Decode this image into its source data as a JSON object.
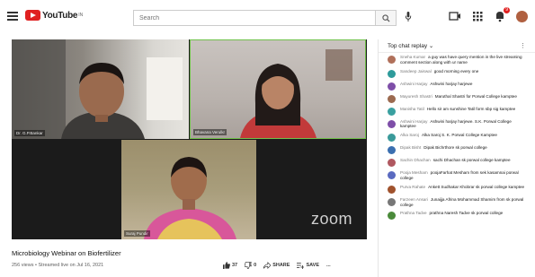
{
  "header": {
    "logo_text": "YouTube",
    "logo_sup": "IN",
    "search_placeholder": "Search",
    "notifications_badge": "9"
  },
  "video": {
    "title": "Microbiology Webinar on Biofertilizer",
    "meta": "256 views • Streamed live on Jul 16, 2021",
    "zoom_watermark": "zoom",
    "tiles": [
      {
        "name": "Dr. G.P.Bankar"
      },
      {
        "name": "Bhavana Verulkr"
      },
      {
        "name": "Suraj Pundir"
      }
    ],
    "actions": {
      "likes": "37",
      "dislikes": "0",
      "share": "SHARE",
      "save": "SAVE",
      "more": "..."
    }
  },
  "chat": {
    "header": "Top chat replay",
    "messages": [
      {
        "author": "Sneha Kumar",
        "text": "a guy was have query mention in the live streaming comment section along with ur name",
        "color": "#b0705a"
      },
      {
        "author": "Sandeep Jaiswal",
        "text": "good morning every one",
        "color": "#2e9b9b"
      },
      {
        "author": "Ashwini Harjay",
        "text": "Ashwini harjay harjewe",
        "color": "#7e4ea8"
      },
      {
        "author": "Mayuresh Shastri",
        "text": "Maruthal Shastri for Porwal College kamptee",
        "color": "#9c6a50"
      },
      {
        "author": "Manisha Tatil",
        "text": "Hello sir am sunshine Tatil form sbp sig kamptee",
        "color": "#3aa0a0"
      },
      {
        "author": "Ashwini Harjay",
        "text": "Ashwini harjay harjewe. S.K. Porwal College kamptee",
        "color": "#7e4ea8"
      },
      {
        "author": "Alka Saroj",
        "text": "Alka Saroj S. K. Porwal College Kamptee",
        "color": "#3a9a9a"
      },
      {
        "author": "Dipak Bisht",
        "text": "Dipak Bichrthore sk porwal college",
        "color": "#3b6fb0"
      },
      {
        "author": "Sachin Dhachan",
        "text": "sachi Dhachan sk porwal college kamptee",
        "color": "#b05860"
      },
      {
        "author": "Pooja Mesham",
        "text": "poojaFarhat Mesham from sek kasamnai porwal college",
        "color": "#5a6ac0"
      },
      {
        "author": "Purva Rahate",
        "text": "Ankett Sudhakar Khobrar sk porwal college kamptee",
        "color": "#a0522d"
      },
      {
        "author": "Farzeen Ansari",
        "text": "Junaijja Afrina Mohammad Shamim from sk porwal college",
        "color": "#777777"
      },
      {
        "author": "Prathna Tadve",
        "text": "prathna Naresh Tadve sk porwal college",
        "color": "#4a8a3a"
      }
    ]
  }
}
